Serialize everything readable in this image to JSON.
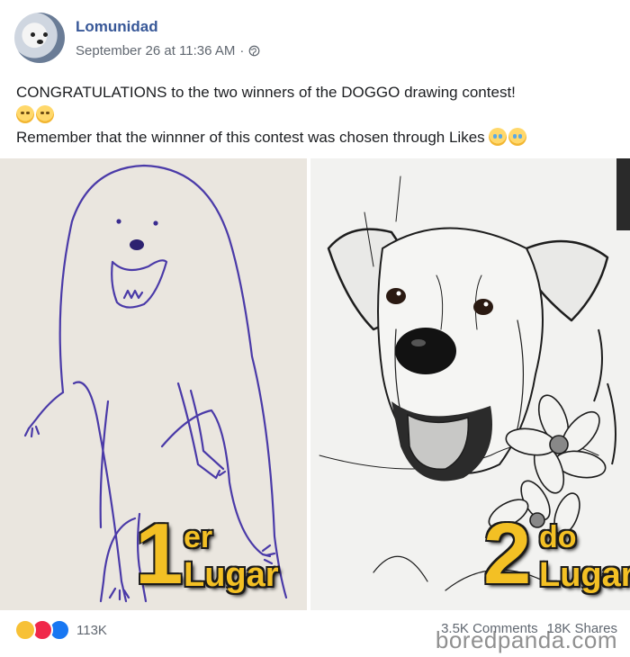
{
  "post": {
    "page_name": "Lomunidad",
    "timestamp": "September 26 at 11:36 AM",
    "separator": "·",
    "privacy_icon": "globe-icon",
    "text_line1": "CONGRATULATIONS to the two winners of the DOGGO drawing contest!",
    "text_line2": "Remember that the winnner of this contest was chosen through Likes"
  },
  "images": {
    "left": {
      "number": "1",
      "suffix": "er",
      "word": "Lugar"
    },
    "right": {
      "number": "2",
      "suffix": "do",
      "word": "Lugar"
    }
  },
  "footer": {
    "reaction_icons": [
      "haha-icon",
      "love-icon",
      "like-icon"
    ],
    "reaction_count": "113K",
    "comments": "3.5K Comments",
    "shares": "18K Shares",
    "watermark": "boredpanda.com"
  },
  "colors": {
    "name": "#385898",
    "meta": "#606770",
    "label_yellow": "#f3c024"
  }
}
